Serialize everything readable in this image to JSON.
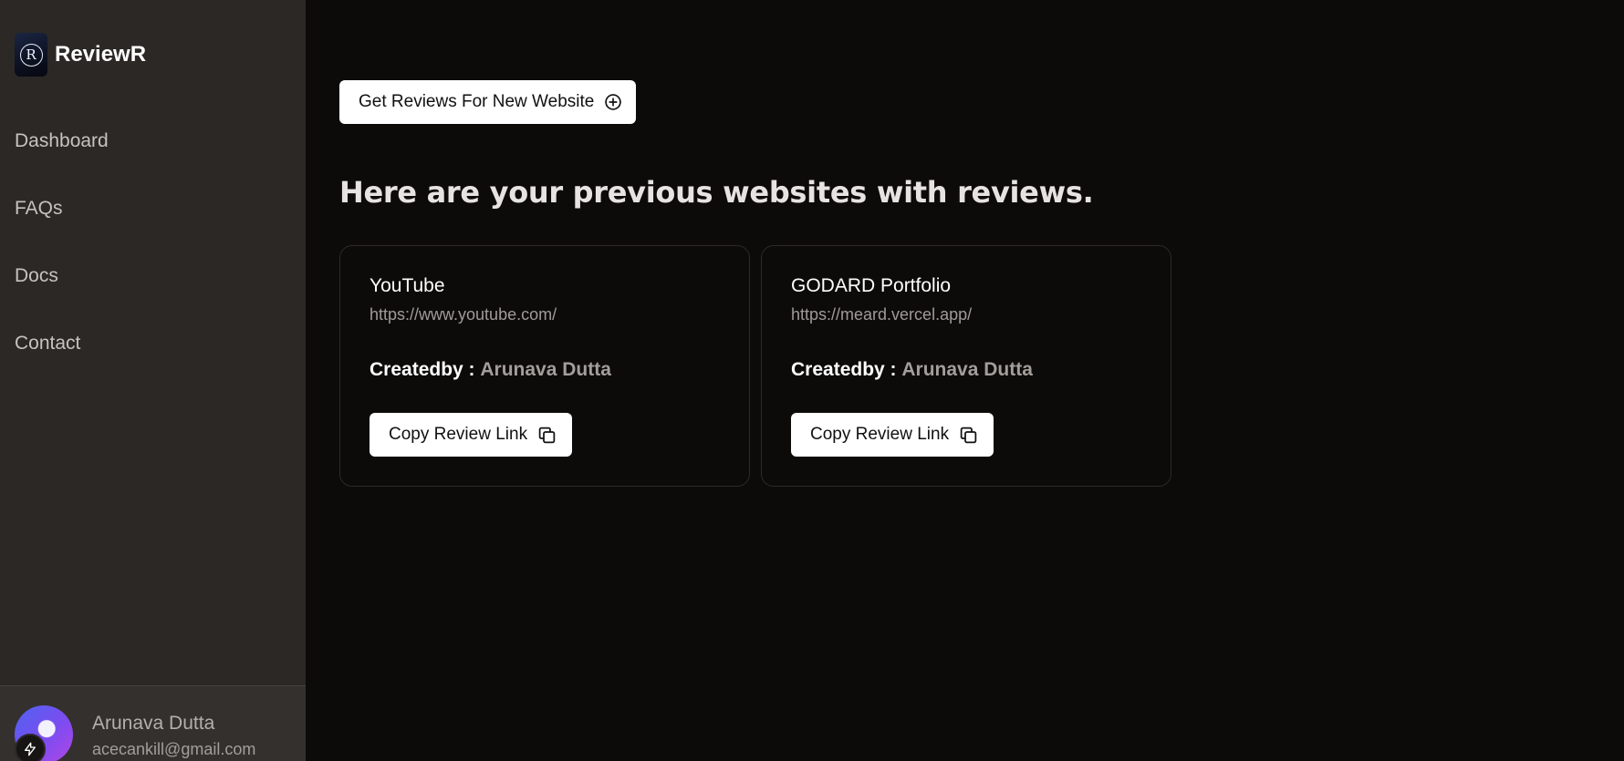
{
  "brand": {
    "name": "ReviewR",
    "logo_letter": "R"
  },
  "sidebar": {
    "items": [
      {
        "label": "Dashboard"
      },
      {
        "label": "FAQs"
      },
      {
        "label": "Docs"
      },
      {
        "label": "Contact"
      }
    ]
  },
  "user": {
    "name": "Arunava Dutta",
    "email": "acecankill@gmail.com"
  },
  "main": {
    "new_site_button": {
      "label": "Get Reviews For New Website",
      "icon": "plus-circle-icon"
    },
    "section_title": "Here are your previous websites with reviews.",
    "cards": [
      {
        "title": "YouTube",
        "url": "https://www.youtube.com/",
        "created_label": "Createdby :",
        "created_by": "Arunava Dutta",
        "copy_label": "Copy Review Link",
        "copy_icon": "copy-icon"
      },
      {
        "title": "GODARD Portfolio",
        "url": "https://meard.vercel.app/",
        "created_label": "Createdby :",
        "created_by": "Arunava Dutta",
        "copy_label": "Copy Review Link",
        "copy_icon": "copy-icon"
      }
    ]
  },
  "colors": {
    "sidebar_bg": "#2b2826",
    "main_bg": "#0c0b0a",
    "button_bg": "#ffffff",
    "muted_text": "#a39e9a"
  }
}
